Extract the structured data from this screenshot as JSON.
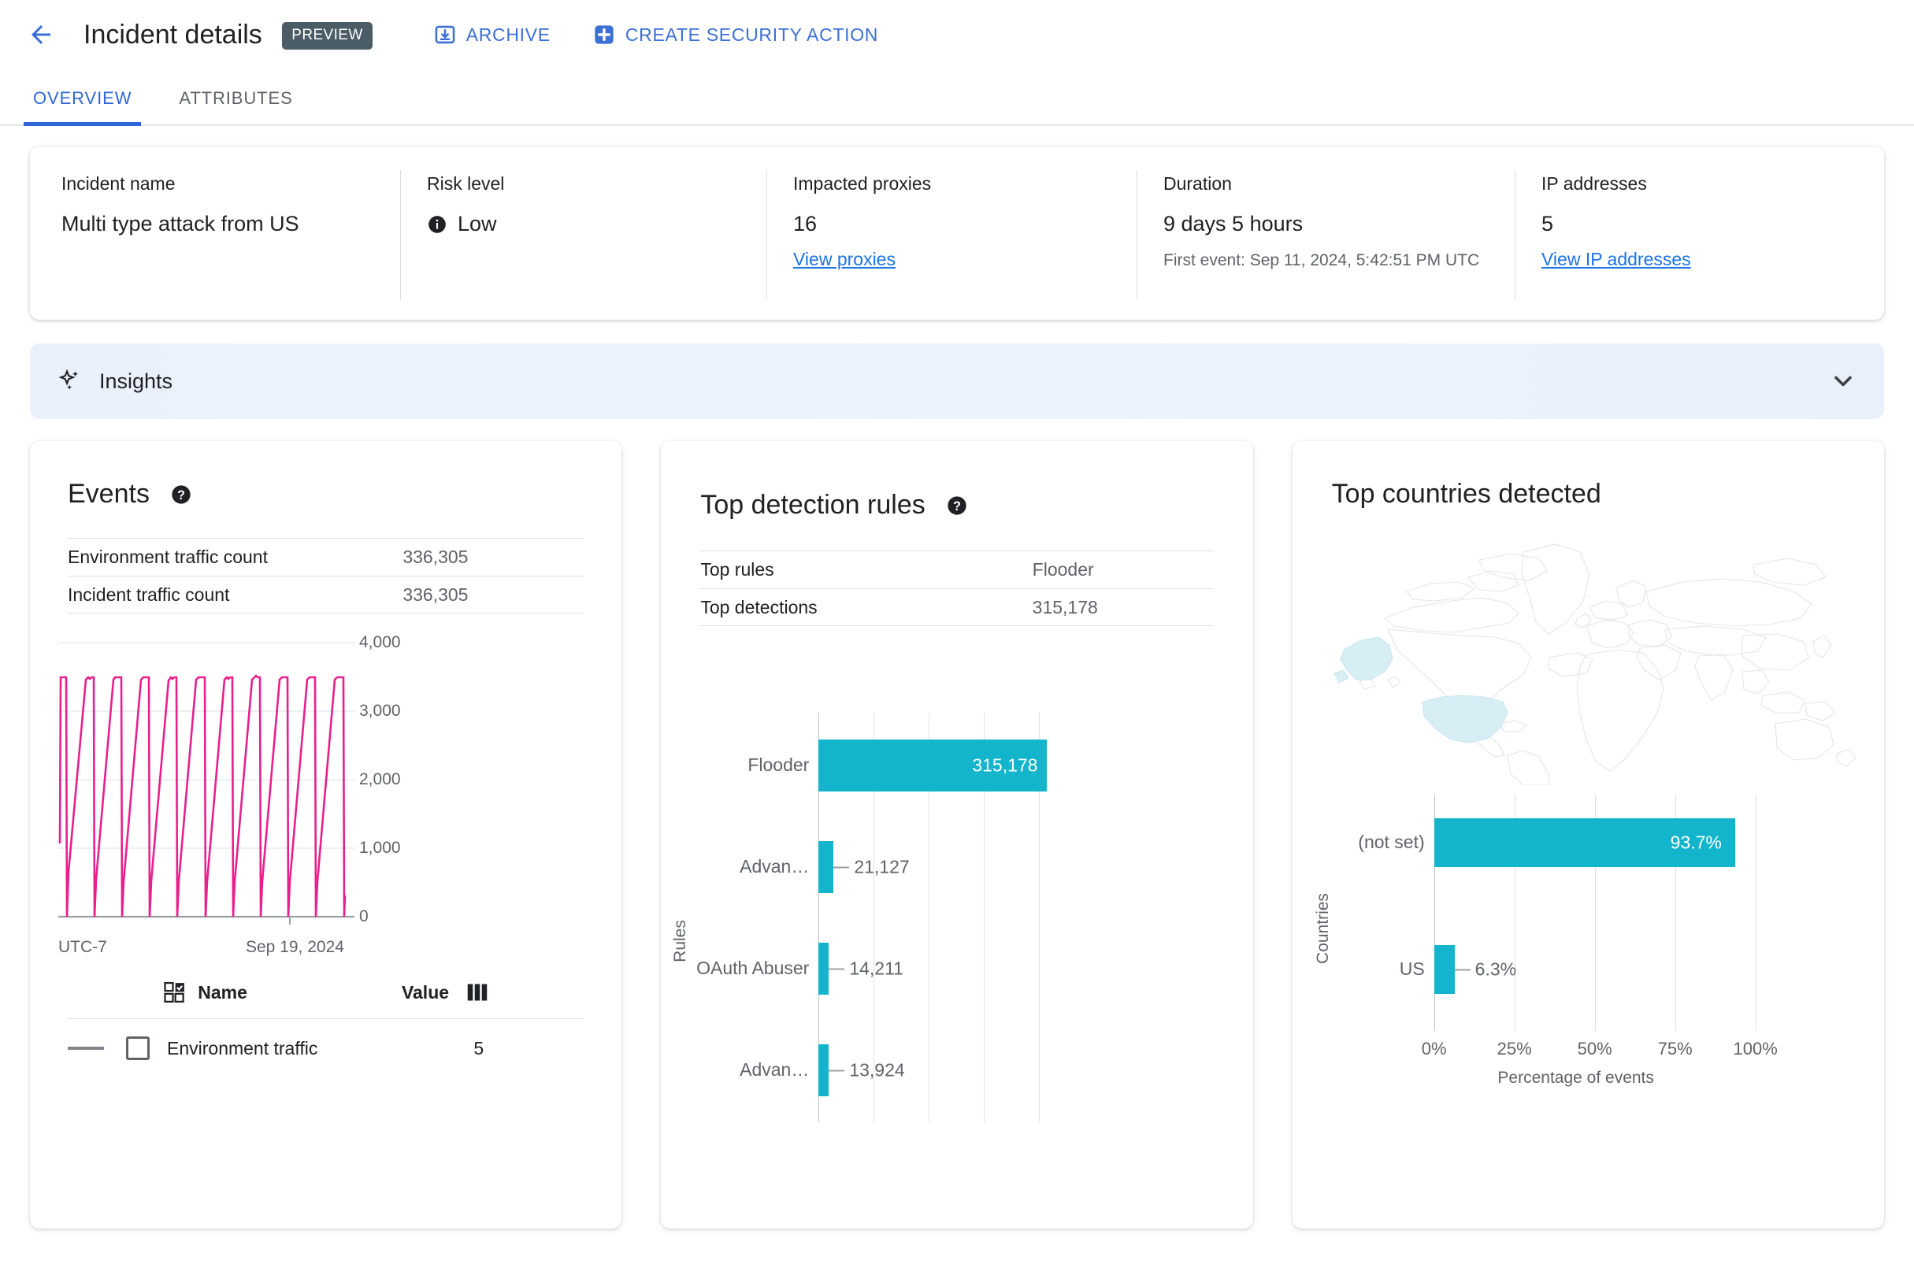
{
  "header": {
    "back_icon": "back-arrow-icon",
    "title": "Incident details",
    "preview_badge": "PREVIEW",
    "actions": [
      {
        "label": "ARCHIVE",
        "icon": "archive-icon"
      },
      {
        "label": "CREATE SECURITY ACTION",
        "icon": "plus-square-icon"
      }
    ],
    "accent_color": "#3c6fd6",
    "badge_color": "#4a5c66"
  },
  "tabs": [
    {
      "label": "OVERVIEW",
      "active": true
    },
    {
      "label": "ATTRIBUTES",
      "active": false
    }
  ],
  "summary": {
    "incident_name": {
      "label": "Incident name",
      "value": "Multi type attack from US"
    },
    "risk_level": {
      "label": "Risk level",
      "value": "Low",
      "icon": "info-icon"
    },
    "impacted_proxies": {
      "label": "Impacted proxies",
      "value": "16",
      "link": "View proxies"
    },
    "duration": {
      "label": "Duration",
      "value": "9 days 5 hours",
      "sub": "First event: Sep 11, 2024, 5:42:51 PM UTC"
    },
    "ip_addresses": {
      "label": "IP addresses",
      "value": "5",
      "link": "View IP addresses"
    }
  },
  "insights": {
    "label": "Insights",
    "icon": "sparkle-icon",
    "chevron": "chevron-down-icon"
  },
  "events_card": {
    "title": "Events",
    "help_icon": "help-icon",
    "rows": [
      {
        "key": "Environment traffic count",
        "value": "336,305"
      },
      {
        "key": "Incident traffic count",
        "value": "336,305"
      }
    ],
    "legend_header": {
      "name": "Name",
      "value": "Value",
      "select_icon": "select-all-icon",
      "columns_icon": "columns-icon"
    },
    "legend_rows": [
      {
        "name": "Environment traffic",
        "value": "5"
      }
    ]
  },
  "rules_card": {
    "title": "Top detection rules",
    "help_icon": "help-icon",
    "rows": [
      {
        "key": "Top rules",
        "value": "Flooder"
      },
      {
        "key": "Top detections",
        "value": "315,178"
      }
    ]
  },
  "countries_card": {
    "title": "Top countries detected",
    "map_highlight_color": "#d8eef5",
    "map_outline_color": "#e3e5e7"
  },
  "chart_data": [
    {
      "type": "line",
      "name": "events-timeseries",
      "title": "Events",
      "xlabel": "UTC-7",
      "ylabel": "",
      "ylim": [
        0,
        4000
      ],
      "yticks": [
        0,
        1000,
        2000,
        3000,
        4000
      ],
      "ytick_labels": [
        "0",
        "1,000",
        "2,000",
        "3,000",
        "4,000"
      ],
      "xtick_labels": [
        "UTC-7",
        "Sep 19, 2024"
      ],
      "xtick_positions": [
        0,
        78
      ],
      "grid": true,
      "series": [
        {
          "name": "Environment traffic",
          "color": "#e8208c",
          "pattern": "sawtooth",
          "peak_value": 3500,
          "trough_value": 0,
          "cycles": 10,
          "values": [
            1050,
            3500,
            3500,
            0,
            3450,
            3500,
            3500,
            0,
            3480,
            3500,
            3500,
            0,
            3470,
            3500,
            3500,
            0,
            3460,
            3520,
            3500,
            0,
            3490,
            3500,
            3500,
            0,
            3470,
            3500,
            3500,
            0,
            3450,
            3530,
            3500,
            0,
            3500,
            3500,
            3500,
            0,
            3500,
            3500,
            3500,
            0
          ]
        }
      ]
    },
    {
      "type": "bar",
      "name": "top-detection-rules",
      "orientation": "horizontal",
      "categories": [
        "Flooder",
        "Advan…",
        "OAuth Abuser",
        "Advan…"
      ],
      "values": [
        315178,
        21127,
        14211,
        13924
      ],
      "value_labels": [
        "315,178",
        "21,127",
        "14,211",
        "13,924"
      ],
      "ylabel": "Rules",
      "xlabel": "",
      "xlim": [
        0,
        340000
      ],
      "bar_color": "#12b5cb",
      "grid": true,
      "gridline_count": 5
    },
    {
      "type": "bar",
      "name": "top-countries-detected",
      "orientation": "horizontal",
      "categories": [
        "(not set)",
        "US"
      ],
      "values": [
        93.7,
        6.3
      ],
      "value_labels": [
        "93.7%",
        "6.3%"
      ],
      "ylabel": "Countries",
      "xlabel": "Percentage of events",
      "xlim": [
        0,
        100
      ],
      "xticks": [
        0,
        25,
        50,
        75,
        100
      ],
      "xtick_labels": [
        "0%",
        "25%",
        "50%",
        "75%",
        "100%"
      ],
      "bar_color": "#12b5cb",
      "grid": true
    }
  ]
}
